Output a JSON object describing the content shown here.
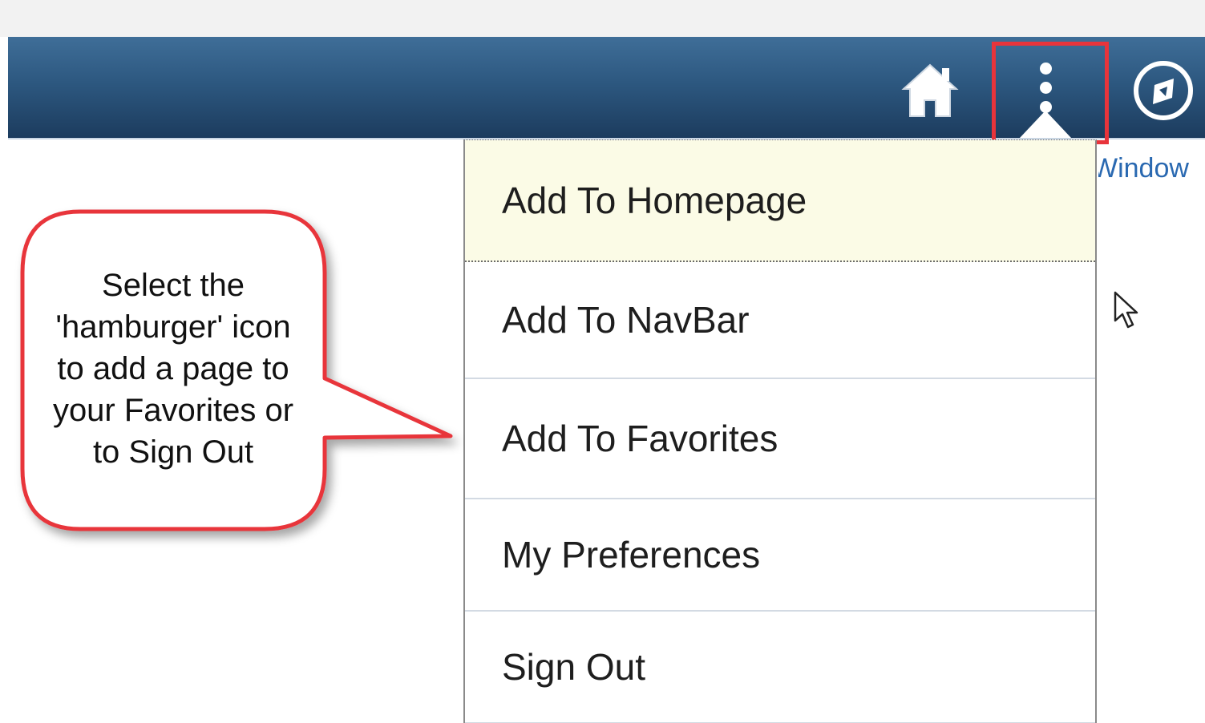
{
  "header": {
    "home_icon": "home-icon",
    "actions_icon": "vertical-ellipsis-icon",
    "navbar_icon": "compass-icon"
  },
  "link": {
    "window_text": "Window"
  },
  "actions_menu": {
    "items": [
      {
        "label": "Add To Homepage",
        "highlighted": true
      },
      {
        "label": "Add To NavBar"
      },
      {
        "label": "Add To Favorites"
      },
      {
        "label": "My Preferences"
      },
      {
        "label": "Sign Out"
      }
    ]
  },
  "callout": {
    "lines": [
      "Select the",
      "'hamburger' icon",
      "to add a page to",
      "your Favorites or",
      "to Sign Out"
    ]
  },
  "colors": {
    "banner_top": "#3f6e98",
    "banner_bottom": "#1c3c5e",
    "highlight_red": "#e8343b",
    "menu_hover": "#fbfbe6",
    "link_blue": "#2a69b1"
  }
}
